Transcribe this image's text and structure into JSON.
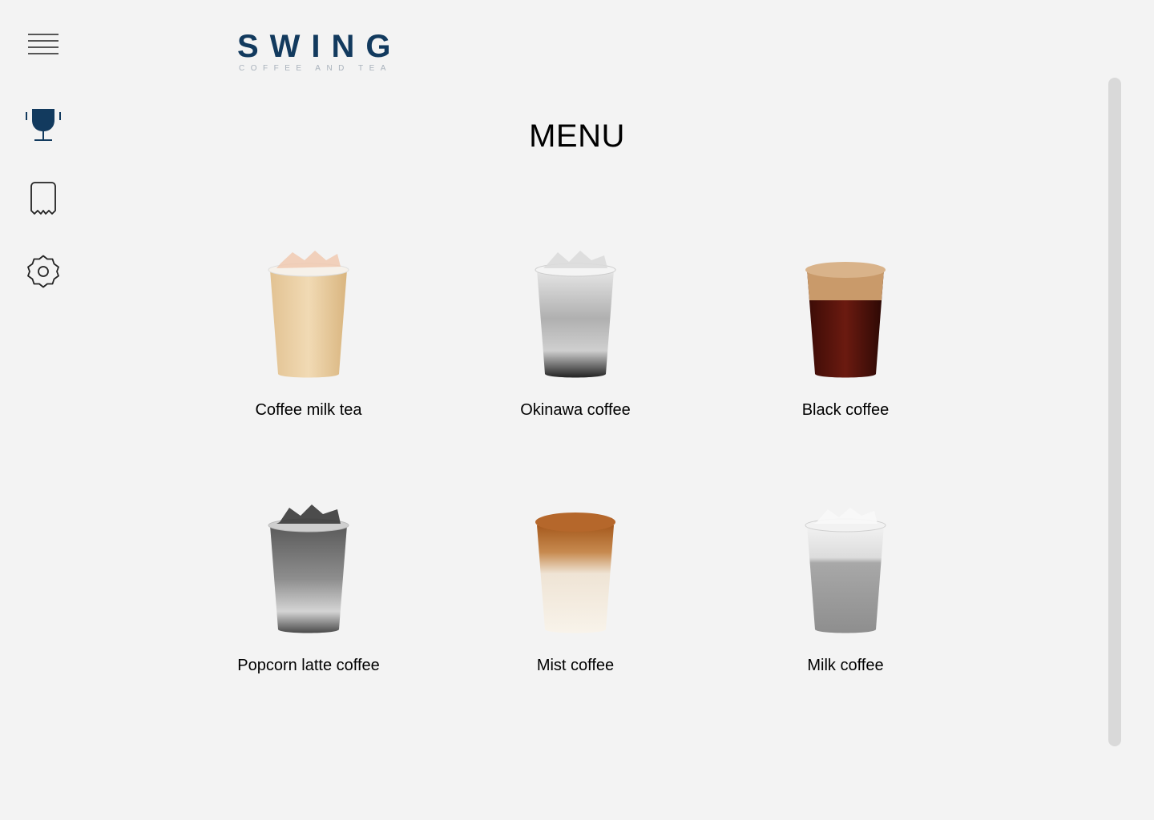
{
  "brand": {
    "name": "SWING",
    "tagline": "COFFEE AND TEA",
    "color": "#123a5e"
  },
  "sidebar": {
    "items": [
      {
        "icon": "hamburger-menu-icon"
      },
      {
        "icon": "trophy-icon",
        "active": true
      },
      {
        "icon": "receipt-icon"
      },
      {
        "icon": "gear-icon"
      }
    ]
  },
  "page": {
    "title": "MENU"
  },
  "menu": {
    "items": [
      {
        "label": "Coffee milk tea"
      },
      {
        "label": "Okinawa coffee"
      },
      {
        "label": "Black coffee"
      },
      {
        "label": "Popcorn latte coffee"
      },
      {
        "label": "Mist coffee"
      },
      {
        "label": "Milk coffee"
      }
    ]
  }
}
